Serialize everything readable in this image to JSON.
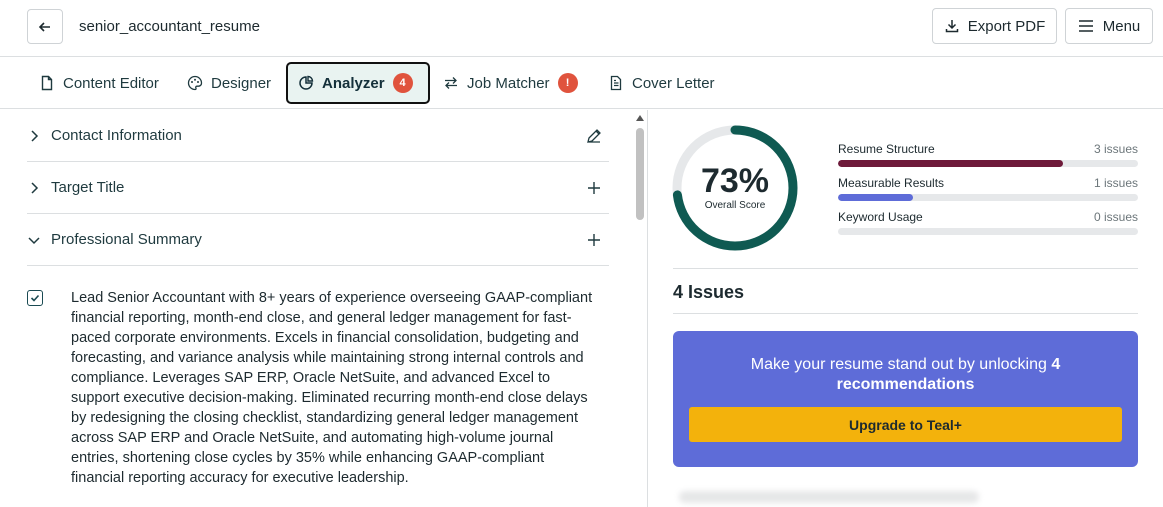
{
  "header": {
    "doc_title": "senior_accountant_resume",
    "export_label": "Export PDF",
    "menu_label": "Menu"
  },
  "tabs": [
    {
      "label": "Content Editor",
      "icon": "document-icon"
    },
    {
      "label": "Designer",
      "icon": "palette-icon"
    },
    {
      "label": "Analyzer",
      "icon": "pie-chart-icon",
      "badge": "4",
      "active": true
    },
    {
      "label": "Job Matcher",
      "icon": "swap-arrows-icon",
      "badge": "!"
    },
    {
      "label": "Cover Letter",
      "icon": "letter-icon"
    }
  ],
  "sections": {
    "contact": "Contact Information",
    "target": "Target Title",
    "summary": "Professional Summary"
  },
  "summary_text": "Lead Senior Accountant with 8+ years of experience overseeing GAAP-compliant financial reporting, month-end close, and general ledger management for fast-paced corporate environments. Excels in financial consolidation, budgeting and forecasting, and variance analysis while maintaining strong internal controls and compliance. Leverages SAP ERP, Oracle NetSuite, and advanced Excel to support executive decision-making. Eliminated recurring month-end close delays by redesigning the closing checklist, standardizing general ledger management across SAP ERP and Oracle NetSuite, and automating high-volume journal entries, shortening close cycles by 35% while enhancing GAAP-compliant financial reporting accuracy for executive leadership.",
  "score": {
    "value": "73%",
    "label": "Overall Score",
    "fraction": 0.73,
    "color": "#0f5a52"
  },
  "metrics": [
    {
      "name": "Resume Structure",
      "issues": "3 issues",
      "fill": 0.75,
      "color": "#6e1a3a"
    },
    {
      "name": "Measurable Results",
      "issues": "1 issues",
      "fill": 0.25,
      "color": "#5e6cd8"
    },
    {
      "name": "Keyword Usage",
      "issues": "0 issues",
      "fill": 0,
      "color": "#5e6cd8"
    }
  ],
  "issues_heading": "4 Issues",
  "promo": {
    "text_before": "Make your resume stand out by unlocking ",
    "text_bold": "4 recommendations",
    "button": "Upgrade to Teal+"
  }
}
